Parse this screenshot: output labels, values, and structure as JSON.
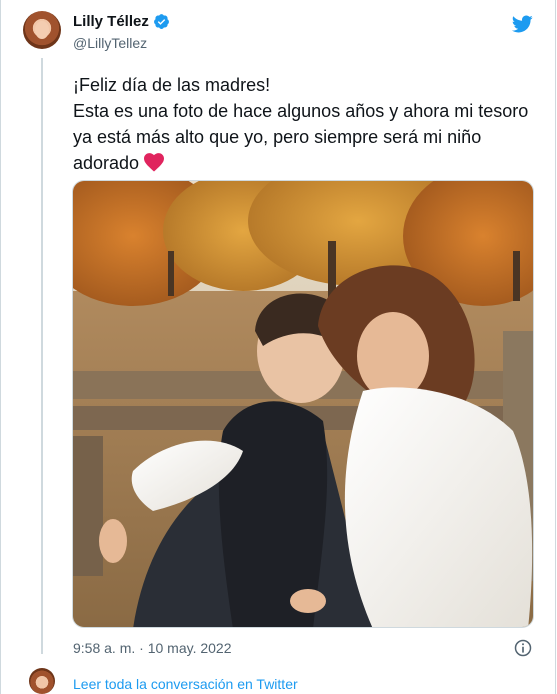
{
  "author": {
    "display_name": "Lilly Téllez",
    "handle": "@LillyTellez",
    "verified": true
  },
  "tweet": {
    "line1": "¡Feliz día de las madres!",
    "line2": "Esta es una foto de hace algunos años y ahora mi tesoro ya está más alto que yo, pero siempre será mi niño adorado",
    "emoji": "heart",
    "timestamp": "9:58 a. m. · 10 may. 2022"
  },
  "footer": {
    "read_conversation": "Leer toda la conversación en Twitter"
  },
  "colors": {
    "twitter_blue": "#1d9bf0",
    "text_primary": "#0f1419",
    "text_secondary": "#536471",
    "border": "#cfd9de",
    "heart_red": "#e0245e"
  },
  "icons": [
    "twitter-bird-icon",
    "verified-badge-icon",
    "heart-icon",
    "info-icon"
  ]
}
